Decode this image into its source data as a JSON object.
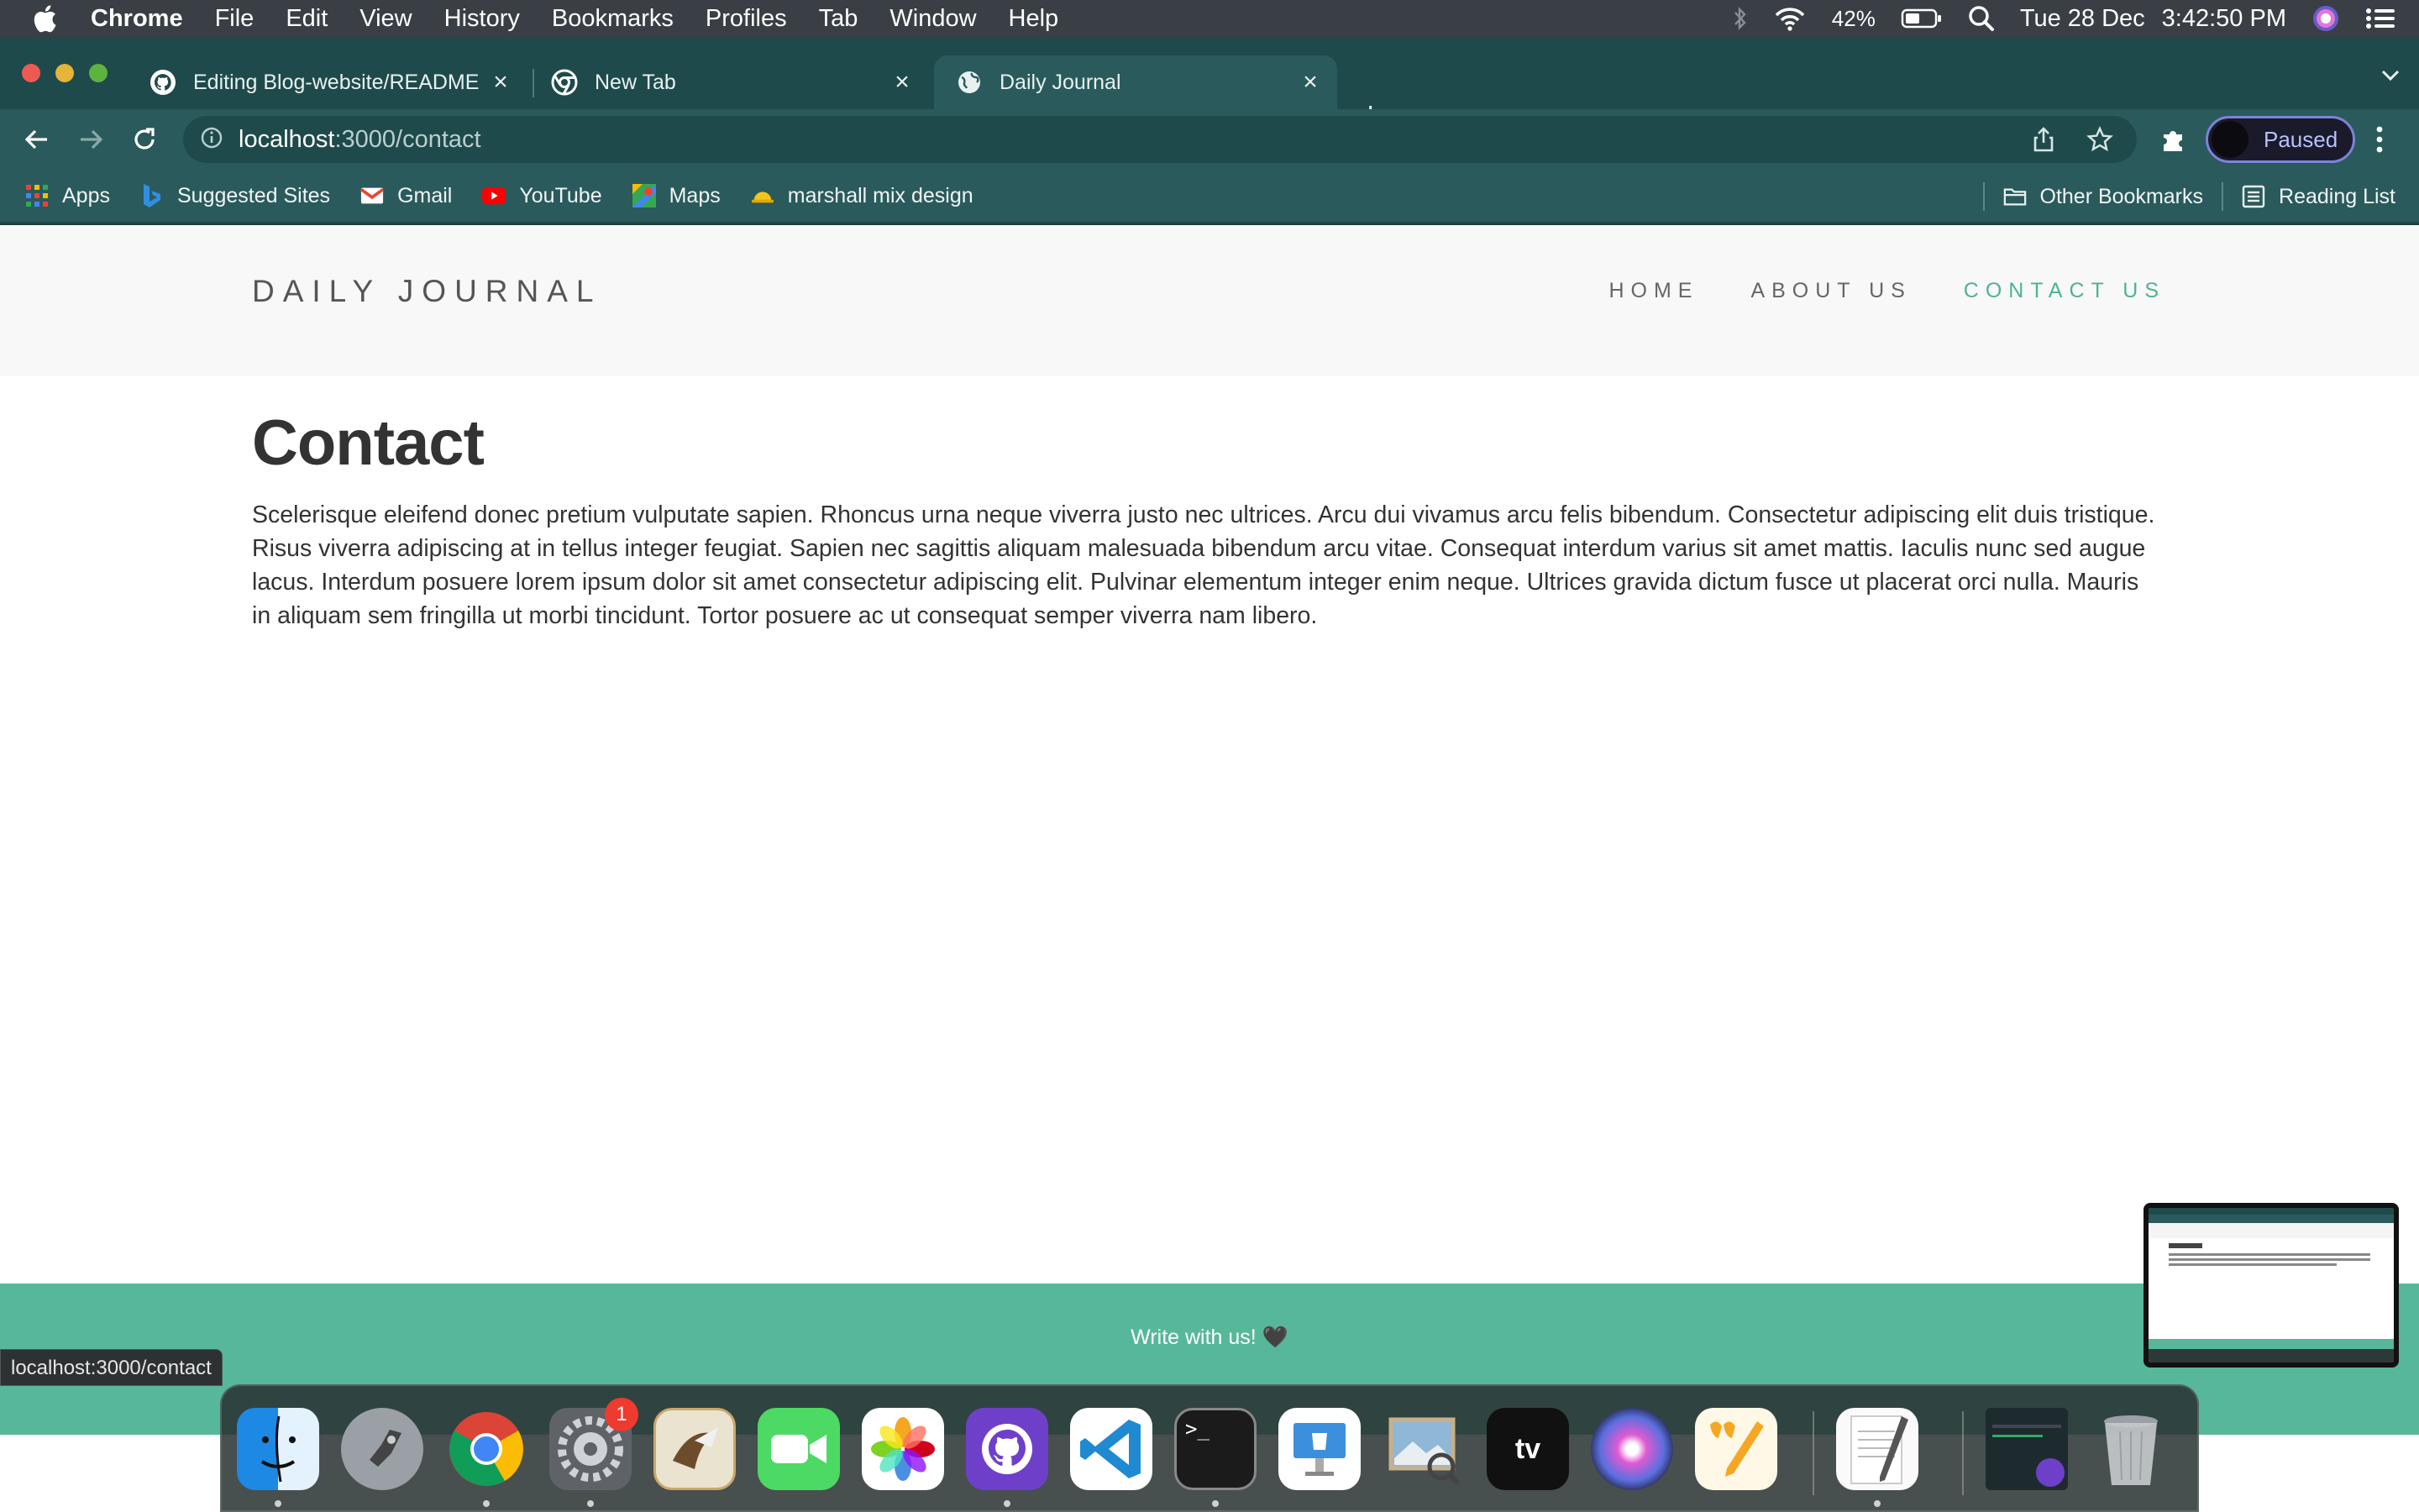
{
  "menubar": {
    "app": "Chrome",
    "items": [
      "File",
      "Edit",
      "View",
      "History",
      "Bookmarks",
      "Profiles",
      "Tab",
      "Window",
      "Help"
    ],
    "battery": "42%",
    "date": "Tue 28 Dec",
    "time": "3:42:50 PM"
  },
  "tabs": [
    {
      "title": "Editing Blog-website/README",
      "icon": "github-icon"
    },
    {
      "title": "New Tab",
      "icon": "chrome-icon"
    },
    {
      "title": "Daily Journal",
      "icon": "globe-icon",
      "active": true
    }
  ],
  "omnibox": {
    "host": "localhost",
    "path": ":3000/contact"
  },
  "profile": {
    "label": "Paused"
  },
  "bookmarks": {
    "left": [
      {
        "label": "Apps",
        "icon": "apps-grid-icon"
      },
      {
        "label": "Suggested Sites",
        "icon": "bing-icon"
      },
      {
        "label": "Gmail",
        "icon": "gmail-icon"
      },
      {
        "label": "YouTube",
        "icon": "youtube-icon"
      },
      {
        "label": "Maps",
        "icon": "maps-icon"
      },
      {
        "label": "marshall mix design",
        "icon": "hardhat-icon"
      }
    ],
    "right": [
      {
        "label": "Other Bookmarks",
        "icon": "folder-icon"
      },
      {
        "label": "Reading List",
        "icon": "reading-list-icon"
      }
    ]
  },
  "site": {
    "brand": "DAILY JOURNAL",
    "nav": [
      "HOME",
      "ABOUT US",
      "CONTACT US"
    ],
    "active_nav": "CONTACT US",
    "heading": "Contact",
    "body": "Scelerisque eleifend donec pretium vulputate sapien. Rhoncus urna neque viverra justo nec ultrices. Arcu dui vivamus arcu felis bibendum. Consectetur adipiscing elit duis tristique. Risus viverra adipiscing at in tellus integer feugiat. Sapien nec sagittis aliquam malesuada bibendum arcu vitae. Consequat interdum varius sit amet mattis. Iaculis nunc sed augue lacus. Interdum posuere lorem ipsum dolor sit amet consectetur adipiscing elit. Pulvinar elementum integer enim neque. Ultrices gravida dictum fusce ut placerat orci nulla. Mauris in aliquam sem fringilla ut morbi tincidunt. Tortor posuere ac ut consequat semper viverra nam libero.",
    "footer": "Write with us! 🖤",
    "accent": "#4fb392",
    "footer_bg": "#57b79a"
  },
  "status_bar_url": "localhost:3000/contact",
  "dock": {
    "apps": [
      "finder-icon",
      "launchpad-icon",
      "chrome-icon",
      "system-preferences-icon",
      "mail-icon",
      "facetime-icon",
      "photos-icon",
      "github-desktop-icon",
      "vscode-icon",
      "terminal-icon",
      "keynote-icon",
      "preview-icon",
      "appletv-icon",
      "siri-icon",
      "pages-icon",
      "textedit-icon",
      "window-thumbnail",
      "trash-icon"
    ],
    "badge": "1"
  }
}
